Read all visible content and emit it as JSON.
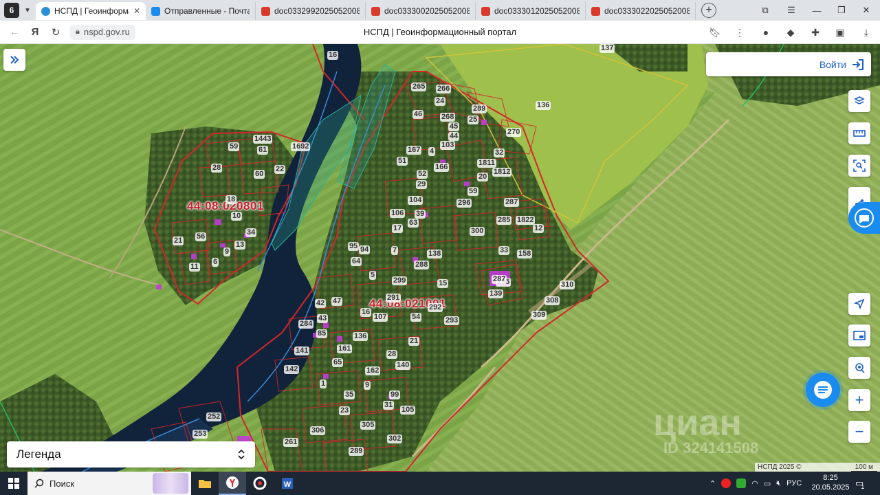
{
  "browser": {
    "tab_counter": "6",
    "tabs": [
      {
        "label": "НСПД | Геоинформац",
        "active": true,
        "favicon_color": "#2a8fd8"
      },
      {
        "label": "Отправленные - Почта",
        "active": false,
        "favicon_color": "#1a8cf0"
      },
      {
        "label": "doc033299202505200820",
        "active": false,
        "favicon_color": "#d93a2b"
      },
      {
        "label": "doc033300202505200820",
        "active": false,
        "favicon_color": "#d93a2b"
      },
      {
        "label": "doc033301202505200820",
        "active": false,
        "favicon_color": "#d93a2b"
      },
      {
        "label": "doc033302202505200820",
        "active": false,
        "favicon_color": "#d93a2b"
      }
    ],
    "url": "nspd.gov.ru",
    "page_title": "НСПД | Геоинформационный портал"
  },
  "map": {
    "login_label": "Войти",
    "legend_label": "Легенда",
    "copyright": "НСПД 2025 ©",
    "scale_label": "100 м",
    "quarters": [
      "44:08:020801",
      "44:08:021001"
    ],
    "plots": [
      "16",
      "137",
      "136",
      "265",
      "266",
      "24",
      "289",
      "46",
      "268",
      "25",
      "45",
      "270",
      "44",
      "103",
      "1443",
      "1692",
      "59",
      "61",
      "167",
      "4",
      "32",
      "1811",
      "1812",
      "51",
      "166",
      "28",
      "60",
      "22",
      "52",
      "20",
      "29",
      "59",
      "296",
      "287",
      "18",
      "104",
      "39",
      "285",
      "1822",
      "12",
      "10",
      "106",
      "63",
      "300",
      "21",
      "56",
      "34",
      "17",
      "95",
      "94",
      "33",
      "158",
      "9",
      "13",
      "64",
      "7",
      "138",
      "288",
      "5",
      "11",
      "6",
      "299",
      "15",
      "310",
      "295",
      "287",
      "139",
      "42",
      "47",
      "291",
      "292",
      "308",
      "16",
      "107",
      "54",
      "293",
      "309",
      "43",
      "284",
      "85",
      "136",
      "21",
      "141",
      "161",
      "28",
      "65",
      "140",
      "142",
      "162",
      "1",
      "9",
      "35",
      "99",
      "31",
      "105",
      "23",
      "305",
      "252",
      "253",
      "306",
      "302",
      "261",
      "289"
    ],
    "watermark_brand": "циан",
    "watermark_id": "ID 324141508"
  },
  "taskbar": {
    "search_placeholder": "Поиск",
    "language": "РУС",
    "time": "8:25",
    "date": "20.05.2025",
    "notification_count": "1"
  }
}
